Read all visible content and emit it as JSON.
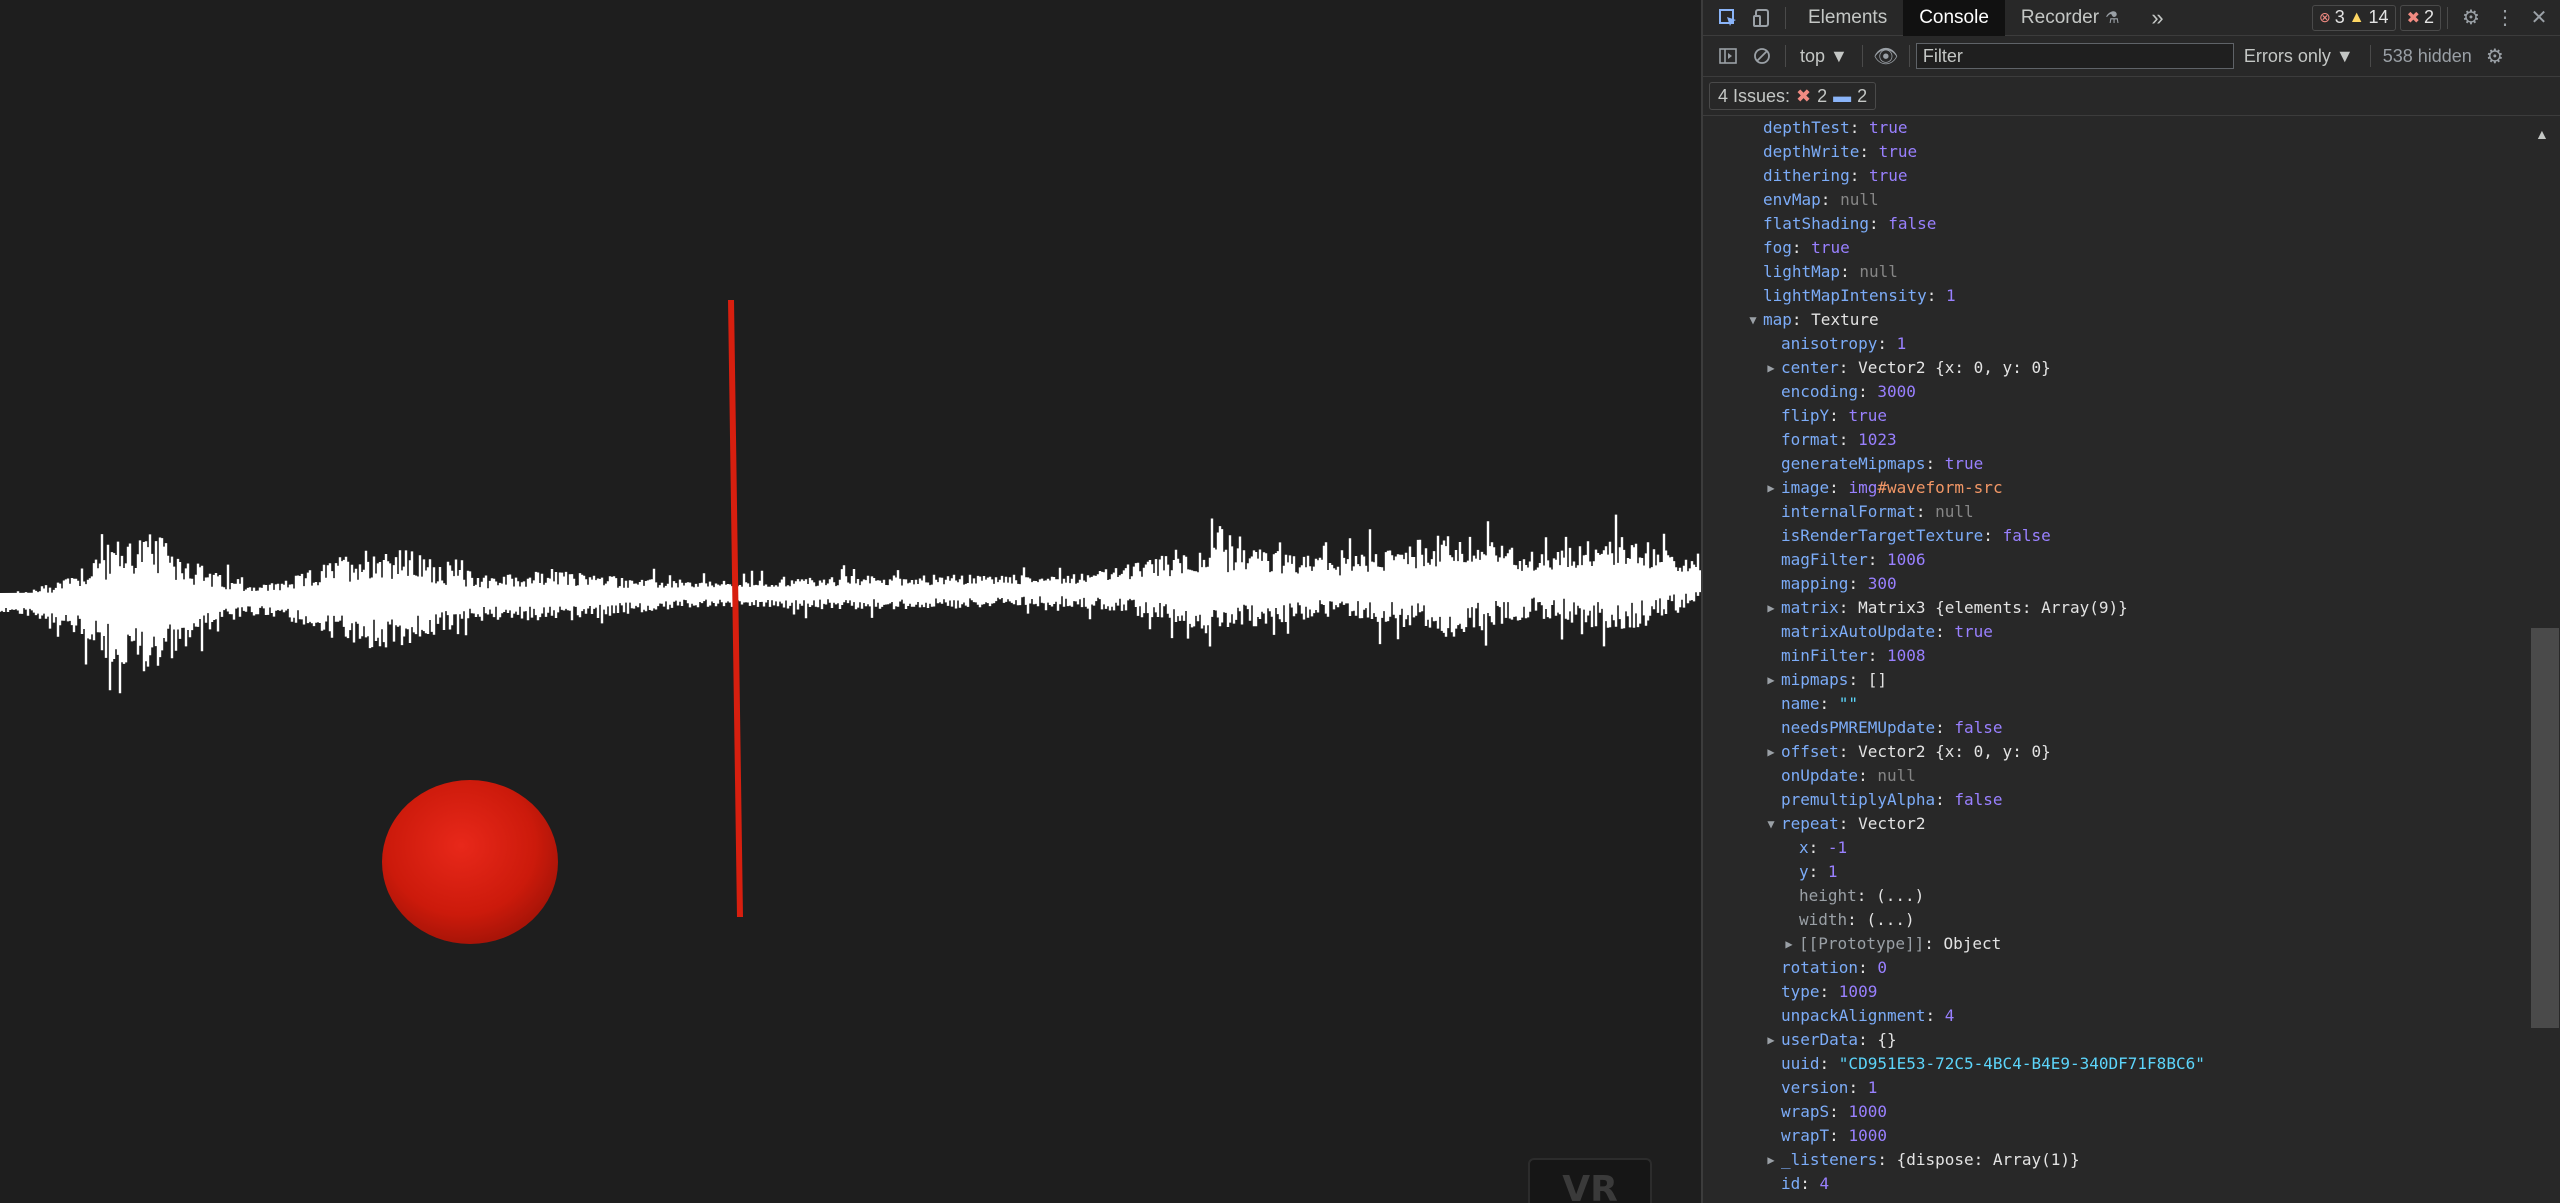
{
  "viewport": {
    "vr_button_label": "VR",
    "colors": {
      "background": "#1e1e1e",
      "waveform": "#ffffff",
      "line": "#d71f0f",
      "sphere": "#d41a0a"
    }
  },
  "devtools": {
    "tabs": [
      "Elements",
      "Console",
      "Recorder",
      "»"
    ],
    "active_tab": "Console",
    "counts": {
      "errors": "3",
      "warnings": "14",
      "issues": "2"
    },
    "context": "top ▼",
    "filter_placeholder": "Filter",
    "log_level": "Errors only ▼",
    "hidden": "538 hidden",
    "issues": {
      "label": "4 Issues:",
      "errors": "2",
      "info": "2"
    }
  },
  "console_lines": [
    {
      "indent": 1,
      "key": "depthTest",
      "value": "true",
      "type": "bool"
    },
    {
      "indent": 1,
      "key": "depthWrite",
      "value": "true",
      "type": "bool"
    },
    {
      "indent": 1,
      "key": "dithering",
      "value": "true",
      "type": "bool"
    },
    {
      "indent": 1,
      "key": "envMap",
      "value": "null",
      "type": "null"
    },
    {
      "indent": 1,
      "key": "flatShading",
      "value": "false",
      "type": "bool"
    },
    {
      "indent": 1,
      "key": "fog",
      "value": "true",
      "type": "bool"
    },
    {
      "indent": 1,
      "key": "lightMap",
      "value": "null",
      "type": "null"
    },
    {
      "indent": 1,
      "key": "lightMapIntensity",
      "value": "1",
      "type": "num"
    },
    {
      "indent": 1,
      "key": "map",
      "value": "Texture",
      "type": "obj",
      "arrow": "open"
    },
    {
      "indent": 2,
      "key": "anisotropy",
      "value": "1",
      "type": "num"
    },
    {
      "indent": 2,
      "key": "center",
      "value": "Vector2 {x: 0, y: 0}",
      "type": "obj",
      "arrow": "closed"
    },
    {
      "indent": 2,
      "key": "encoding",
      "value": "3000",
      "type": "num"
    },
    {
      "indent": 2,
      "key": "flipY",
      "value": "true",
      "type": "bool"
    },
    {
      "indent": 2,
      "key": "format",
      "value": "1023",
      "type": "num"
    },
    {
      "indent": 2,
      "key": "generateMipmaps",
      "value": "true",
      "type": "bool"
    },
    {
      "indent": 2,
      "key": "image",
      "value": "img#waveform-src",
      "type": "img",
      "arrow": "closed"
    },
    {
      "indent": 2,
      "key": "internalFormat",
      "value": "null",
      "type": "null"
    },
    {
      "indent": 2,
      "key": "isRenderTargetTexture",
      "value": "false",
      "type": "bool"
    },
    {
      "indent": 2,
      "key": "magFilter",
      "value": "1006",
      "type": "num"
    },
    {
      "indent": 2,
      "key": "mapping",
      "value": "300",
      "type": "num"
    },
    {
      "indent": 2,
      "key": "matrix",
      "value": "Matrix3 {elements: Array(9)}",
      "type": "obj",
      "arrow": "closed"
    },
    {
      "indent": 2,
      "key": "matrixAutoUpdate",
      "value": "true",
      "type": "bool"
    },
    {
      "indent": 2,
      "key": "minFilter",
      "value": "1008",
      "type": "num"
    },
    {
      "indent": 2,
      "key": "mipmaps",
      "value": "[]",
      "type": "obj",
      "arrow": "closed"
    },
    {
      "indent": 2,
      "key": "name",
      "value": "\"\"",
      "type": "str"
    },
    {
      "indent": 2,
      "key": "needsPMREMUpdate",
      "value": "false",
      "type": "bool"
    },
    {
      "indent": 2,
      "key": "offset",
      "value": "Vector2 {x: 0, y: 0}",
      "type": "obj",
      "arrow": "closed"
    },
    {
      "indent": 2,
      "key": "onUpdate",
      "value": "null",
      "type": "null"
    },
    {
      "indent": 2,
      "key": "premultiplyAlpha",
      "value": "false",
      "type": "bool"
    },
    {
      "indent": 2,
      "key": "repeat",
      "value": "Vector2",
      "type": "obj",
      "arrow": "open"
    },
    {
      "indent": 3,
      "key": "x",
      "value": "-1",
      "type": "num"
    },
    {
      "indent": 3,
      "key": "y",
      "value": "1",
      "type": "num"
    },
    {
      "indent": 3,
      "key": "height",
      "value": "(...)",
      "type": "obj",
      "dim": true
    },
    {
      "indent": 3,
      "key": "width",
      "value": "(...)",
      "type": "obj",
      "dim": true
    },
    {
      "indent": 3,
      "key": "[[Prototype]]",
      "value": "Object",
      "type": "obj",
      "arrow": "closed",
      "dim": true
    },
    {
      "indent": 2,
      "key": "rotation",
      "value": "0",
      "type": "num"
    },
    {
      "indent": 2,
      "key": "type",
      "value": "1009",
      "type": "num"
    },
    {
      "indent": 2,
      "key": "unpackAlignment",
      "value": "4",
      "type": "num"
    },
    {
      "indent": 2,
      "key": "userData",
      "value": "{}",
      "type": "obj",
      "arrow": "closed"
    },
    {
      "indent": 2,
      "key": "uuid",
      "value": "\"CD951E53-72C5-4BC4-B4E9-340DF71F8BC6\"",
      "type": "str"
    },
    {
      "indent": 2,
      "key": "version",
      "value": "1",
      "type": "num"
    },
    {
      "indent": 2,
      "key": "wrapS",
      "value": "1000",
      "type": "num"
    },
    {
      "indent": 2,
      "key": "wrapT",
      "value": "1000",
      "type": "num"
    },
    {
      "indent": 2,
      "key": "_listeners",
      "value": "{dispose: Array(1)}",
      "type": "obj",
      "arrow": "closed"
    },
    {
      "indent": 2,
      "key": "id",
      "value": "4",
      "type": "num"
    }
  ]
}
